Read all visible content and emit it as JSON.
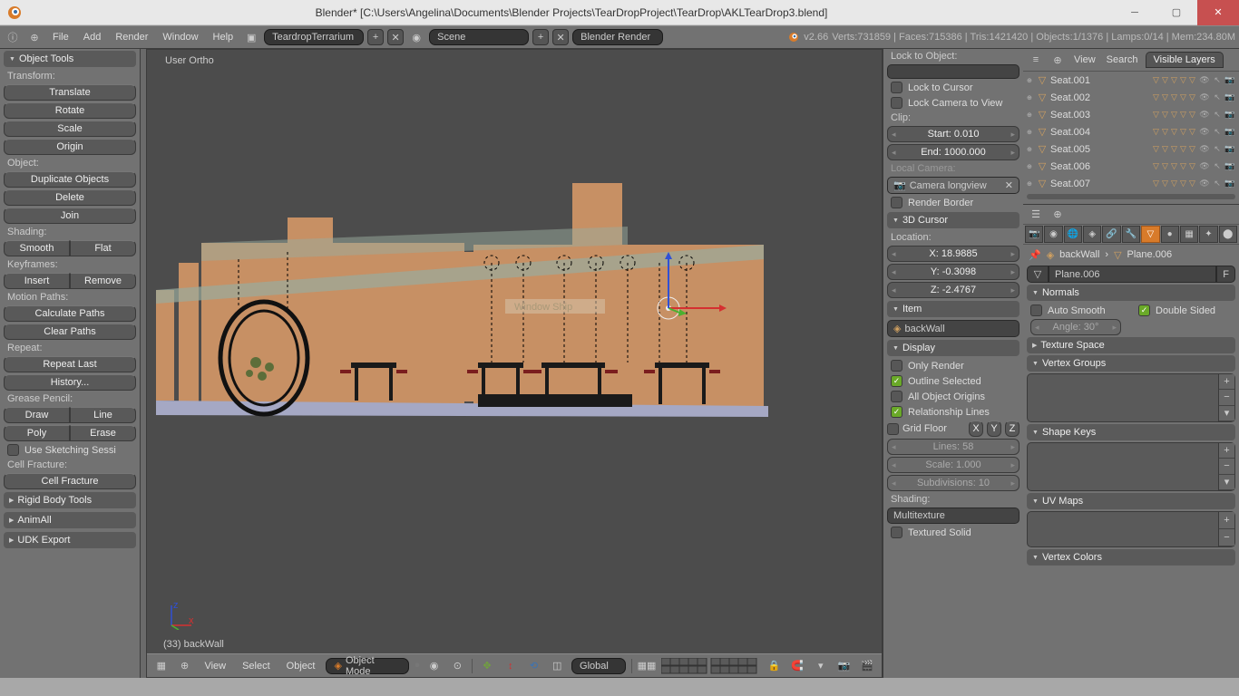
{
  "titlebar": {
    "title": "Blender* [C:\\Users\\Angelina\\Documents\\Blender Projects\\TearDropProject\\TearDrop\\AKLTearDrop3.blend]"
  },
  "info": {
    "version": "v2.66",
    "stats": "Verts:731859 | Faces:715386 | Tris:1421420 | Objects:1/1376 | Lamps:0/14 | Mem:234.80M"
  },
  "menu": {
    "file": "File",
    "add": "Add",
    "render": "Render",
    "window": "Window",
    "help": "Help",
    "scene_dropdown": "TeardropTerrarium",
    "scene2": "Scene",
    "renderer": "Blender Render"
  },
  "viewport": {
    "topLabel": "User Ortho",
    "footer": "(33) backWall",
    "view": "View",
    "select": "Select",
    "object": "Object",
    "mode": "Object Mode",
    "orient": "Global"
  },
  "toolshelf": {
    "title": "Object Tools",
    "transform": "Transform:",
    "translate": "Translate",
    "rotate": "Rotate",
    "scale": "Scale",
    "origin": "Origin",
    "objectSec": "Object:",
    "dup": "Duplicate Objects",
    "delete": "Delete",
    "join": "Join",
    "shadingSec": "Shading:",
    "smooth": "Smooth",
    "flat": "Flat",
    "keyframes": "Keyframes:",
    "insert": "Insert",
    "remove": "Remove",
    "mpaths": "Motion Paths:",
    "calc": "Calculate Paths",
    "clear": "Clear Paths",
    "repeat": "Repeat:",
    "repeatLast": "Repeat Last",
    "history": "History...",
    "gp": "Grease Pencil:",
    "draw": "Draw",
    "line": "Line",
    "poly": "Poly",
    "erase": "Erase",
    "sketching": "Use Sketching Sessi",
    "cellFrac": "Cell Fracture:",
    "cellFracBtn": "Cell Fracture",
    "rbt": "Rigid Body Tools",
    "animall": "AnimAll",
    "udk": "UDK Export"
  },
  "npanel": {
    "lockObj": "Lock to Object:",
    "lockCur": "Lock to Cursor",
    "lockCam": "Lock Camera to View",
    "clip": "Clip:",
    "start": "Start: 0.010",
    "end": "End: 1000.000",
    "localCam": "Local Camera:",
    "camName": "Camera longview",
    "renderBorder": "Render Border",
    "cursor3d": "3D Cursor",
    "loc": "Location:",
    "x": "X: 18.9885",
    "y": "Y: -0.3098",
    "z": "Z: -2.4767",
    "item": "Item",
    "itemName": "backWall",
    "display": "Display",
    "onlyRender": "Only Render",
    "outline": "Outline Selected",
    "origins": "All Object Origins",
    "rel": "Relationship Lines",
    "gridFloor": "Grid Floor",
    "gfX": "X",
    "gfY": "Y",
    "gfZ": "Z",
    "lines": "Lines: 58",
    "scalev": "Scale: 1.000",
    "subs": "Subdivisions: 10",
    "shading": "Shading:",
    "multitex": "Multitexture",
    "texSolid": "Textured Solid"
  },
  "outliner": {
    "view": "View",
    "search": "Search",
    "visible": "Visible Layers",
    "rows": [
      "Seat.001",
      "Seat.002",
      "Seat.003",
      "Seat.004",
      "Seat.005",
      "Seat.006",
      "Seat.007"
    ]
  },
  "props": {
    "bc1": "backWall",
    "bc2": "Plane.006",
    "dataName": "Plane.006",
    "pin": "F",
    "normals": "Normals",
    "autoSmooth": "Auto Smooth",
    "doubleSided": "Double Sided",
    "angle": "Angle: 30°",
    "texSpace": "Texture Space",
    "vg": "Vertex Groups",
    "sk": "Shape Keys",
    "uv": "UV Maps",
    "vc": "Vertex Colors"
  },
  "statsline": {}
}
